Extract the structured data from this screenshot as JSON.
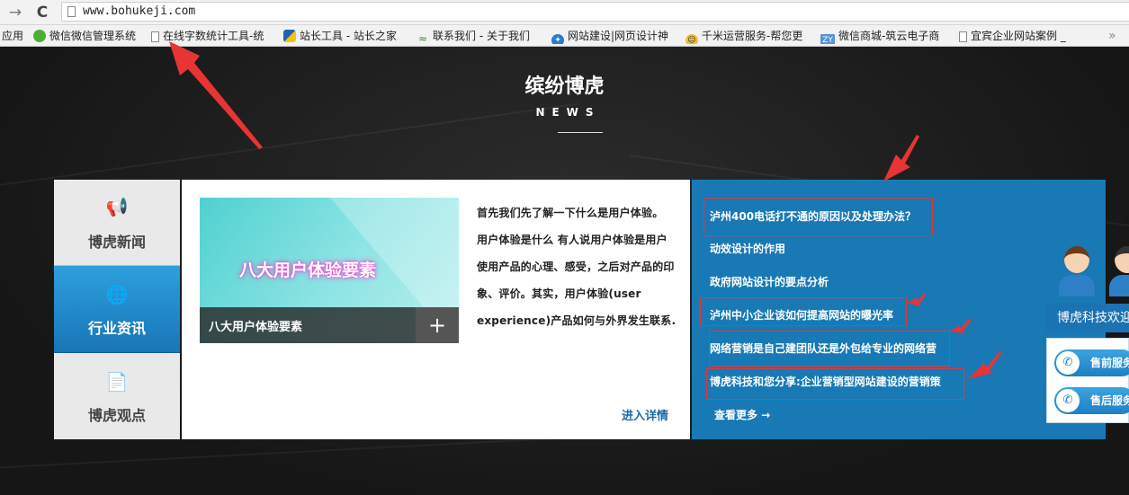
{
  "browser": {
    "back_icon": "arrow-left-icon",
    "back_glyph": "→",
    "reload_icon": "reload-icon",
    "reload_glyph": "C",
    "url": "www.bohukeji.com"
  },
  "bookmarks": [
    {
      "label": "应用",
      "icon": "apps-icon"
    },
    {
      "label": "微信微信管理系统",
      "icon": "wechat-icon"
    },
    {
      "label": "在线字数统计工具-统",
      "icon": "page-icon"
    },
    {
      "label": "站长工具 - 站长之家",
      "icon": "chinaz-icon"
    },
    {
      "label": "联系我们 - 关于我们",
      "icon": "feather-icon"
    },
    {
      "label": "网站建设|网页设计神",
      "icon": "star-icon"
    },
    {
      "label": "千米运营服务-帮您更",
      "icon": "emoji-icon"
    },
    {
      "label": "微信商城-筑云电子商",
      "icon": "zy-icon"
    },
    {
      "label": "宜宾企业网站案例 _",
      "icon": "page-icon"
    }
  ],
  "section": {
    "title": "缤纷博虎",
    "subtitle": "NEWS"
  },
  "tabs": [
    {
      "label": "博虎新闻",
      "icon": "megaphone-icon",
      "glyph": "📢",
      "active": false
    },
    {
      "label": "行业资讯",
      "icon": "globe-icon",
      "glyph": "🌐",
      "active": true
    },
    {
      "label": "博虎观点",
      "icon": "document-icon",
      "glyph": "📄",
      "active": false
    }
  ],
  "article": {
    "image_text": "八大用户体验要素",
    "caption": "八大用户体验要素",
    "plus": "+",
    "excerpt_lines": [
      "首先我们先了解一下什么是用户体验。",
      "用户体验是什么 有人说用户体验是用户",
      "使用产品的心理、感受，之后对产品的印",
      "象、评价。其实，用户体验(user",
      "experience)产品如何与外界发生联系..."
    ],
    "detail_link": "进入详情"
  },
  "news_list": {
    "items": [
      "泸州400电话打不通的原因以及处理办法？",
      "动效设计的作用",
      "政府网站设计的要点分析",
      "泸州中小企业该如何提高网站的曝光率",
      "网络营销是自己建团队还是外包给专业的网络营",
      "博虎科技和您分享:企业营销型网站建设的营销策"
    ],
    "more_link": "查看更多 →"
  },
  "customer_service": {
    "banner": "博虎科技欢迎",
    "buttons": [
      "售前服务",
      "售后服务"
    ],
    "button_icon": "chat-icon"
  },
  "colors": {
    "accent_blue": "#1879b4",
    "annotation_red": "#e23838"
  }
}
